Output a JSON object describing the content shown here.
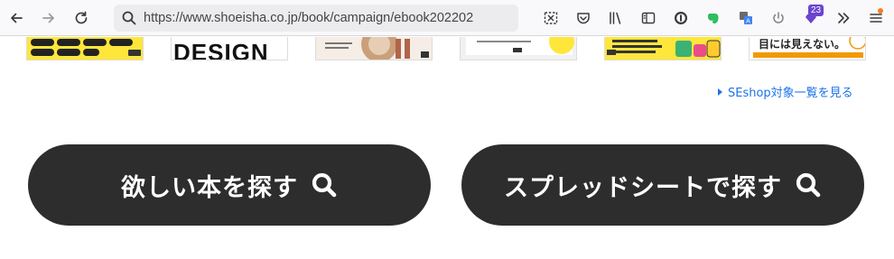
{
  "browser": {
    "url": "https://www.shoeisha.co.jp/book/campaign/ebook202202",
    "extensions_badge": "23",
    "icons": [
      "back-icon",
      "forward-icon",
      "reload-icon",
      "search-icon",
      "screenshot-icon",
      "pocket-icon",
      "library-icon",
      "sidebar-icon",
      "adblock-icon",
      "evernote-icon",
      "translate-icon",
      "power-icon",
      "extension-icon",
      "overflow-icon",
      "menu-icon"
    ]
  },
  "books": {
    "book2_title_fragment": "DESIGN",
    "book6_title_fragment": "目には見えない。"
  },
  "link": {
    "label": "SEshop対象一覧を見る"
  },
  "buttons": {
    "find_book": "欲しい本を探す",
    "find_spreadsheet": "スプレッドシートで探す"
  },
  "colors": {
    "button_bg": "#2d2d2d",
    "link": "#1a73e8",
    "badge": "#6b44cf"
  }
}
